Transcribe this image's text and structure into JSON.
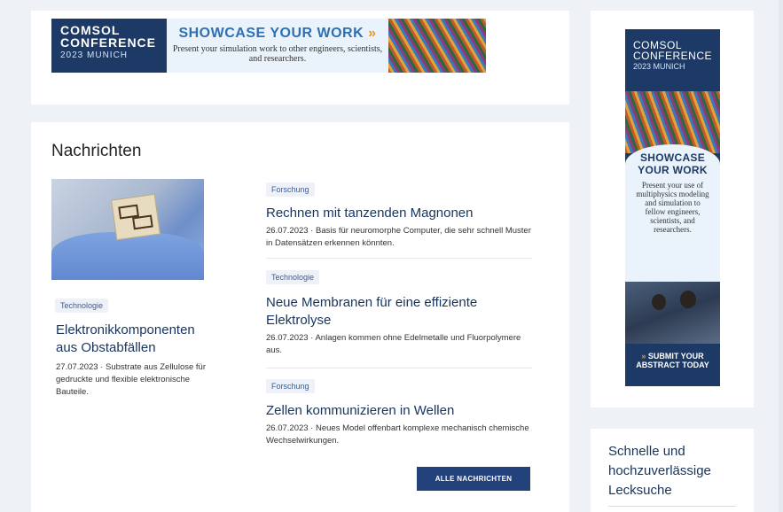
{
  "banner": {
    "logo_line1": "COMSOL",
    "logo_line2": "CONFERENCE",
    "logo_line3": "2023 MUNICH",
    "headline": "SHOWCASE YOUR WORK",
    "arrows": "»",
    "subline": "Present your simulation work to other engineers, scientists, and researchers."
  },
  "news": {
    "section_title": "Nachrichten",
    "featured": {
      "tag": "Technologie",
      "title": "Elektronikkomponenten aus Obstabfällen",
      "description": "27.07.2023 · Substrate aus Zellulose für gedruckte und flexible elektronische Bauteile."
    },
    "articles": [
      {
        "tag": "Forschung",
        "title": "Rechnen mit tanzenden Magnonen",
        "description": "26.07.2023 · Basis für neuromorphe Computer, die sehr schnell Muster in Datensätzen erkennen könnten."
      },
      {
        "tag": "Technologie",
        "title": "Neue Membranen für eine effiziente Elektrolyse",
        "description": "26.07.2023 · Anlagen kommen ohne Edelmetalle und Fluorpolymere aus."
      },
      {
        "tag": "Forschung",
        "title": "Zellen kommunizieren in Wellen",
        "description": "26.07.2023 · Neues Model offenbart komplexe mechanisch chemische Wechselwirkungen."
      }
    ],
    "all_news_label": "ALLE NACHRICHTEN"
  },
  "side_ad": {
    "logo_line1": "COMSOL",
    "logo_line2": "CONFERENCE",
    "logo_line3": "2023 MUNICH",
    "headline_line1": "SHOWCASE",
    "headline_line2": "YOUR WORK",
    "subline": "Present your use of multiphysics modeling and simulation to fellow engineers, scientists, and researchers.",
    "cta_arrows": "»",
    "cta_line1": "SUBMIT YOUR",
    "cta_line2": "ABSTRACT TODAY"
  },
  "side_text": {
    "title": "Schnelle und hochzuverlässige Lecksuche"
  }
}
